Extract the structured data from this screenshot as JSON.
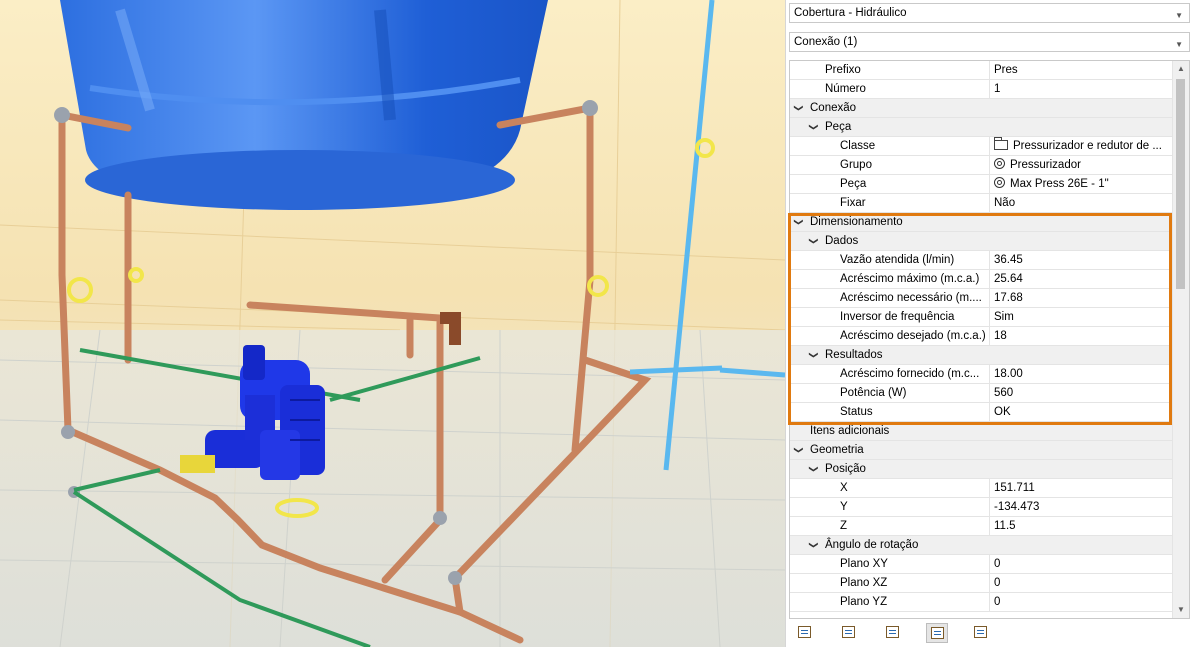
{
  "panel": {
    "discipline_combo": "Cobertura - Hidráulico",
    "selection_combo": "Conexão (1)",
    "rows": [
      {
        "type": "prop",
        "level": 1,
        "name": "Prefixo",
        "value": "Pres"
      },
      {
        "type": "prop",
        "level": 1,
        "name": "Número",
        "value": "1"
      },
      {
        "type": "group",
        "level": 0,
        "name": "Conexão"
      },
      {
        "type": "group",
        "level": 1,
        "name": "Peça"
      },
      {
        "type": "prop",
        "level": 2,
        "name": "Classe",
        "value": "Pressurizador e redutor de ...",
        "icon": "folder-icon"
      },
      {
        "type": "prop",
        "level": 2,
        "name": "Grupo",
        "value": "Pressurizador",
        "icon": "valve-symbol-icon"
      },
      {
        "type": "prop",
        "level": 2,
        "name": "Peça",
        "value": "Max Press 26E - 1\"",
        "icon": "valve-symbol-icon"
      },
      {
        "type": "prop",
        "level": 2,
        "name": "Fixar",
        "value": "Não"
      },
      {
        "type": "group",
        "level": 0,
        "name": "Dimensionamento"
      },
      {
        "type": "group",
        "level": 1,
        "name": "Dados"
      },
      {
        "type": "prop",
        "level": 2,
        "name": "Vazão atendida (l/min)",
        "value": "36.45"
      },
      {
        "type": "prop",
        "level": 2,
        "name": "Acréscimo máximo (m.c.a.)",
        "value": "25.64"
      },
      {
        "type": "prop",
        "level": 2,
        "name": "Acréscimo necessário (m....",
        "value": "17.68"
      },
      {
        "type": "prop",
        "level": 2,
        "name": "Inversor de frequência",
        "value": "Sim"
      },
      {
        "type": "prop",
        "level": 2,
        "name": "Acréscimo desejado (m.c.a.)",
        "value": "18"
      },
      {
        "type": "group",
        "level": 1,
        "name": "Resultados"
      },
      {
        "type": "prop",
        "level": 2,
        "name": "Acréscimo fornecido (m.c...",
        "value": "18.00"
      },
      {
        "type": "prop",
        "level": 2,
        "name": "Potência (W)",
        "value": "560"
      },
      {
        "type": "prop",
        "level": 2,
        "name": "Status",
        "value": "OK"
      },
      {
        "type": "group",
        "level": 0,
        "name": "Itens adicionais",
        "nochevron": true
      },
      {
        "type": "group",
        "level": 0,
        "name": "Geometria"
      },
      {
        "type": "group",
        "level": 1,
        "name": "Posição"
      },
      {
        "type": "prop",
        "level": 2,
        "name": "X",
        "value": "151.711"
      },
      {
        "type": "prop",
        "level": 2,
        "name": "Y",
        "value": "-134.473"
      },
      {
        "type": "prop",
        "level": 2,
        "name": "Z",
        "value": "11.5"
      },
      {
        "type": "group",
        "level": 1,
        "name": "Ângulo de rotação"
      },
      {
        "type": "prop",
        "level": 2,
        "name": "Plano XY",
        "value": "0"
      },
      {
        "type": "prop",
        "level": 2,
        "name": "Plano XZ",
        "value": "0"
      },
      {
        "type": "prop",
        "level": 2,
        "name": "Plano YZ",
        "value": "0"
      }
    ]
  },
  "toolbar": {
    "buttons": [
      {
        "name": "properties-tab-button",
        "icon": "list-tree-icon"
      },
      {
        "name": "view-tab-button",
        "icon": "window-icon"
      },
      {
        "name": "structure-tab-button",
        "icon": "tree-icon"
      },
      {
        "name": "check-tab-button",
        "icon": "checklist-icon",
        "active": true
      },
      {
        "name": "add-connection-button",
        "icon": "plus-gear-icon"
      }
    ]
  },
  "colors": {
    "highlight": "#e07a10",
    "water_tank": "#1f6ee8",
    "pump": "#1a2ed8",
    "copper_pipe": "#c8835e",
    "green_pipe": "#2f9a5a",
    "blue_pipe": "#5ab8ef",
    "valve_handle": "#f2e64a",
    "background": "#f7e8bc"
  }
}
